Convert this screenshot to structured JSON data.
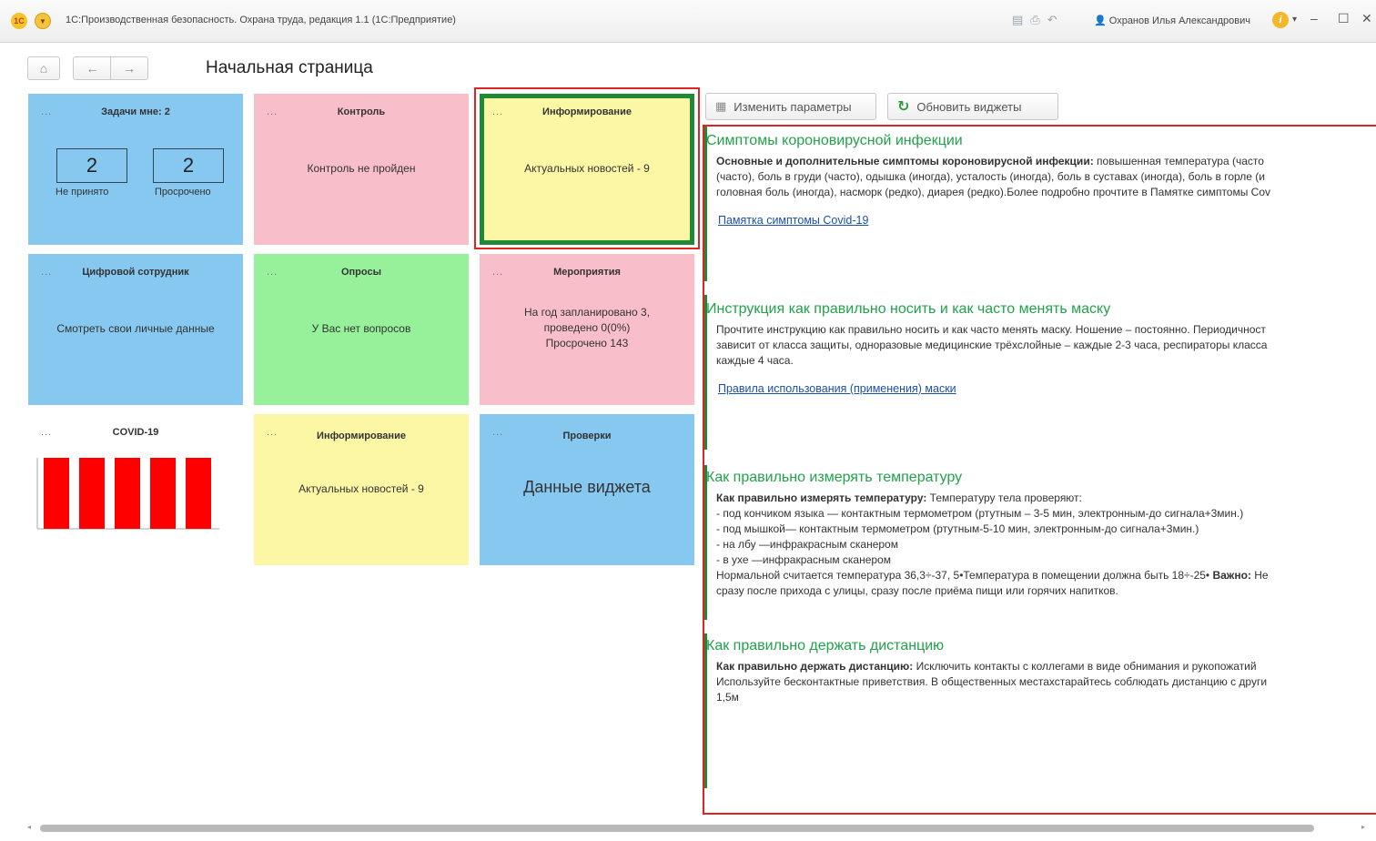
{
  "window": {
    "title": "1С:Производственная безопасность. Охрана труда, редакция 1.1 (1С:Предприятие)",
    "user": "Охранов Илья Александрович",
    "logo": "1С"
  },
  "nav": {
    "page_title": "Начальная страница"
  },
  "tiles": {
    "tasks": {
      "dots": "...",
      "title": "Задачи мне: 2",
      "not_accepted_count": "2",
      "not_accepted_label": "Не принято",
      "overdue_count": "2",
      "overdue_label": "Просрочено"
    },
    "control": {
      "dots": "...",
      "title": "Контроль",
      "body": "Контроль не пройден"
    },
    "info_top": {
      "dots": "...",
      "title": "Информирование",
      "body": "Актуальных новостей - 9"
    },
    "digital": {
      "dots": "...",
      "title": "Цифровой сотрудник",
      "body": "Смотреть свои личные данные"
    },
    "surveys": {
      "dots": "...",
      "title": "Опросы",
      "body": "У Вас нет вопросов"
    },
    "events": {
      "dots": "...",
      "title": "Мероприятия",
      "line1": "На год запланировано 3,",
      "line2": "проведено 0(0%)",
      "line3": "Просрочено 143"
    },
    "covid": {
      "dots": "...",
      "title": "COVID-19"
    },
    "info_bottom": {
      "dots": "...",
      "title": "Информирование",
      "body": "Актуальных новостей - 9"
    },
    "checks": {
      "dots": "...",
      "title": "Проверки",
      "body": "Данные виджета"
    }
  },
  "toolbar": {
    "change_params": "Изменить параметры",
    "refresh_widgets": "Обновить виджеты"
  },
  "news": [
    {
      "title": "Симптомы короновирусной инфекции",
      "lines": [
        {
          "bold": "Основные и дополнительные симптомы короновирусной инфекции:",
          "text": " повышенная температура (часто"
        },
        {
          "bold": "",
          "text": "(часто), боль в груди (часто), одышка (иногда), усталость (иногда), боль в суставах (иногда), боль в горле (и"
        },
        {
          "bold": "",
          "text": "головная боль (иногда), насморк (редко), диарея (редко).Более подробно прочтите в Памятке симптомы Cov"
        }
      ],
      "link": "Памятка симптомы Covid-19"
    },
    {
      "title": "Инструкция как правильно носить и как часто менять маску",
      "lines": [
        {
          "bold": "",
          "text": "Прочтите инструкцию как правильно носить и как часто менять маску. Ношение – постоянно. Периодичност"
        },
        {
          "bold": "",
          "text": "зависит от класса защиты, одноразовые медицинские трёхслойные – каждые 2-3 часа, респираторы класса"
        },
        {
          "bold": "",
          "text": "каждые 4 часа."
        }
      ],
      "link": "Правила использования (применения) маски"
    },
    {
      "title": "Как правильно измерять температуру",
      "lines": [
        {
          "bold": "Как правильно измерять температуру:",
          "text": " Температуру тела проверяют:"
        },
        {
          "bold": "",
          "text": "- под кончиком языка — контактным термометром (ртутным – 3-5 мин, электронным-до сигнала+3мин.)"
        },
        {
          "bold": "",
          "text": "- под мышкой— контактным термометром (ртутным-5-10 мин, электронным-до сигнала+3мин.)"
        },
        {
          "bold": "",
          "text": "- на лбу —инфракрасным сканером"
        },
        {
          "bold": "",
          "text": "- в ухе —инфракрасным сканером"
        },
        {
          "bold": "",
          "text": "Нормальной считается температура  36,3÷-37, 5•Температура в помещении должна быть 18÷-25• "
        },
        {
          "bold": "",
          "text": "сразу после прихода с улицы, сразу после приёма пищи или горячих напитков."
        }
      ],
      "important": "Важно:",
      "tail": " Не"
    },
    {
      "title": "Как правильно держать дистанцию",
      "lines": [
        {
          "bold": "Как правильно держать дистанцию:",
          "text": " Исключить  контакты с коллегами в виде обнимания  и  рукопожатий"
        },
        {
          "bold": "",
          "text": " Используйте бесконтактные приветствия. В общественных местахстарайтесь соблюдать дистанцию с други"
        },
        {
          "bold": "",
          "text": "1,5м"
        }
      ]
    }
  ],
  "chart_data": {
    "type": "bar",
    "title": "COVID-19",
    "categories": [
      "",
      "",
      "",
      "",
      ""
    ],
    "values": [
      1,
      1,
      1,
      1,
      1
    ],
    "colors": [
      "#ff0000"
    ]
  },
  "colors": {
    "accent_red": "#e02424",
    "accent_green": "#1f8a36",
    "news_title": "#22a24a"
  },
  "icons": {
    "home": "home-icon",
    "back": "arrow-left-icon",
    "forward": "arrow-right-icon",
    "settings": "settings-icon",
    "refresh": "refresh-icon"
  }
}
